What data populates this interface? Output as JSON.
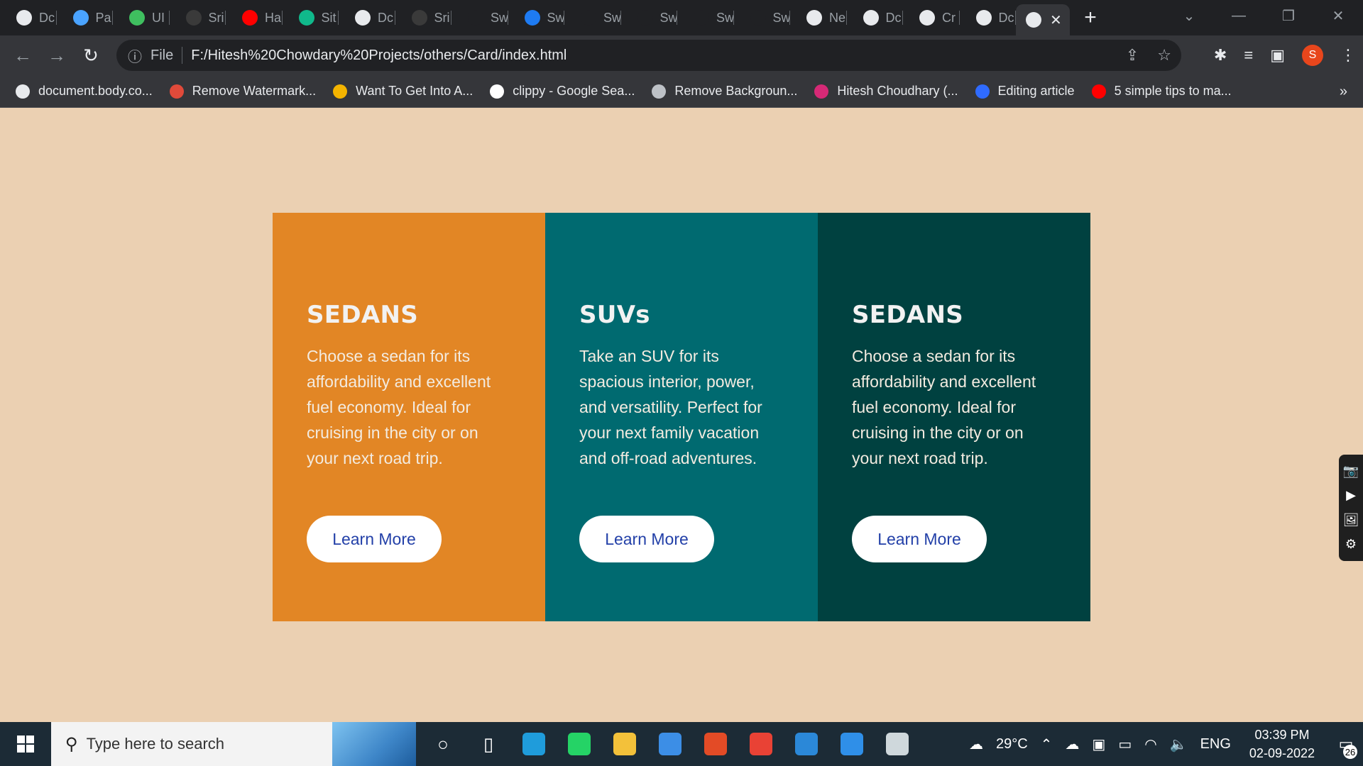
{
  "browser": {
    "tabs": [
      {
        "label": "Dc",
        "icon": "globe-icon",
        "color": "#e8eaed"
      },
      {
        "label": "Pa",
        "icon": "code-brackets-icon",
        "color": "#4aa3ff"
      },
      {
        "label": "UI",
        "icon": "play-bracket-icon",
        "color": "#3fbf5f"
      },
      {
        "label": "Sri",
        "icon": "github-icon",
        "color": "#3a3a3a"
      },
      {
        "label": "Ha",
        "icon": "youtube-icon",
        "color": "#ff0000"
      },
      {
        "label": "Sit",
        "icon": "diamond-icon",
        "color": "#10b98b"
      },
      {
        "label": "Dc",
        "icon": "globe-icon",
        "color": "#e8eaed"
      },
      {
        "label": "Sri",
        "icon": "github-icon",
        "color": "#3a3a3a"
      },
      {
        "label": "Sw",
        "icon": "square-icon",
        "color": "#202124"
      },
      {
        "label": "Sw",
        "icon": "s-logo-icon",
        "color": "#1e7bf2"
      },
      {
        "label": "Sw",
        "icon": "square-icon",
        "color": "#202124"
      },
      {
        "label": "Sw",
        "icon": "square-icon",
        "color": "#202124"
      },
      {
        "label": "Sw",
        "icon": "square-icon",
        "color": "#202124"
      },
      {
        "label": "Sw",
        "icon": "square-icon",
        "color": "#202124"
      },
      {
        "label": "Ne",
        "icon": "chrome-icon",
        "color": "#e8eaed"
      },
      {
        "label": "Dc",
        "icon": "globe-icon",
        "color": "#e8eaed"
      },
      {
        "label": "Cr",
        "icon": "globe-icon",
        "color": "#e8eaed"
      },
      {
        "label": "Dc",
        "icon": "globe-icon",
        "color": "#e8eaed"
      }
    ],
    "active_tab_close": "✕",
    "new_tab": "+",
    "window_controls": {
      "tabsearch": "⌄",
      "minimize": "—",
      "restore": "❐",
      "close": "✕"
    },
    "nav": {
      "back": "←",
      "forward": "→",
      "reload": "↻"
    },
    "omnibox": {
      "info": "ⓘ",
      "scheme": "File",
      "url": "F:/Hitesh%20Chowdary%20Projects/others/Card/index.html",
      "share": "⇪",
      "star": "☆"
    },
    "toolbar": {
      "extensions": "✱",
      "media": "≡",
      "sidepanel": "▣",
      "avatar": "S",
      "menu": "⋮"
    },
    "bookmarks": [
      {
        "label": "document.body.co...",
        "icon": "globe-icon",
        "color": "#e8eaed"
      },
      {
        "label": "Remove Watermark...",
        "icon": "eraser-icon",
        "color": "#e04a3a"
      },
      {
        "label": "Want To Get Into A...",
        "icon": "slides-icon",
        "color": "#f4b400"
      },
      {
        "label": "clippy - Google Sea...",
        "icon": "google-icon",
        "color": "#ffffff"
      },
      {
        "label": "Remove Backgroun...",
        "icon": "wave-icon",
        "color": "#bdc1c6"
      },
      {
        "label": "Hitesh Choudhary (...",
        "icon": "instagram-icon",
        "color": "#d62976"
      },
      {
        "label": "Editing article",
        "icon": "diamond-icon",
        "color": "#2f6bff"
      },
      {
        "label": "5 simple tips to ma...",
        "icon": "youtube-icon",
        "color": "#ff0000"
      }
    ],
    "bookmarks_more": "»"
  },
  "page": {
    "background": "#ebd0b2",
    "cards": [
      {
        "title": "SEDANS",
        "description": "Choose a sedan for its affordability and excellent fuel economy. Ideal for cruising in the city or on your next road trip.",
        "button": "Learn More",
        "color": "#e28625"
      },
      {
        "title": "SUVs",
        "description": "Take an SUV for its spacious interior, power, and versatility. Perfect for your next family vacation and off-road adventures.",
        "button": "Learn More",
        "color": "#006a70"
      },
      {
        "title": "SEDANS",
        "description": "Choose a sedan for its affordability and excellent fuel economy. Ideal for cruising in the city or on your next road trip.",
        "button": "Learn More",
        "color": "#004140"
      }
    ],
    "side_widget": [
      "📷",
      "▶",
      "🖼",
      "⚙"
    ]
  },
  "taskbar": {
    "search_placeholder": "Type here to search",
    "apps": [
      {
        "name": "cortana-icon",
        "glyph": "○",
        "color": "#ffffff"
      },
      {
        "name": "task-view-icon",
        "glyph": "▯",
        "color": "#ffffff"
      },
      {
        "name": "edge-icon",
        "glyph": "",
        "color": "#1f9cdb"
      },
      {
        "name": "whatsapp-icon",
        "glyph": "",
        "color": "#25d366"
      },
      {
        "name": "file-explorer-icon",
        "glyph": "",
        "color": "#f3c13a"
      },
      {
        "name": "mail-icon",
        "glyph": "",
        "color": "#3c8ee6"
      },
      {
        "name": "office-icon",
        "glyph": "",
        "color": "#e34b26"
      },
      {
        "name": "chrome-icon",
        "glyph": "",
        "color": "#e94235"
      },
      {
        "name": "photos-icon",
        "glyph": "",
        "color": "#2b88d8"
      },
      {
        "name": "vscode-icon",
        "glyph": "",
        "color": "#2f8fe8"
      },
      {
        "name": "screen-recorder-icon",
        "glyph": "",
        "color": "#cfd8dc"
      }
    ],
    "weather": "29°C",
    "language": "ENG",
    "time": "03:39 PM",
    "date": "02-09-2022",
    "notifications": "26"
  }
}
